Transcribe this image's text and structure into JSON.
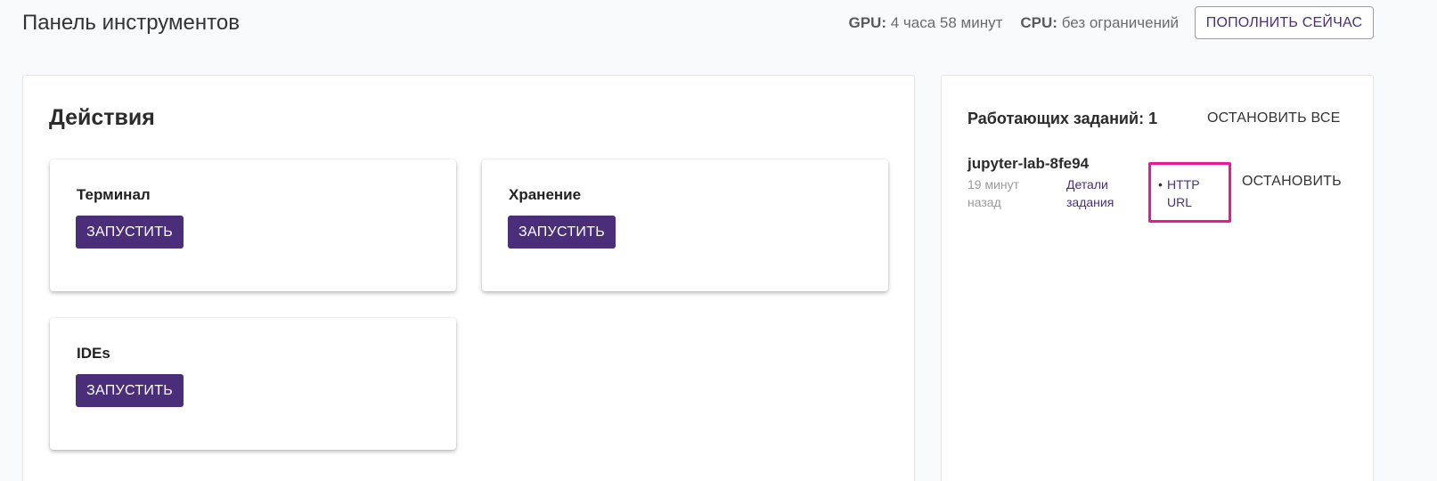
{
  "header": {
    "title": "Панель инструментов",
    "gpu_label": "GPU:",
    "gpu_value": "4 часа 58 минут",
    "cpu_label": "CPU:",
    "cpu_value": "без ограничений",
    "topup_label": "ПОПОЛНИТЬ СЕЙЧАС"
  },
  "actions": {
    "title": "Действия",
    "cards": [
      {
        "title": "Терминал",
        "button": "ЗАПУСТИТЬ"
      },
      {
        "title": "Хранение",
        "button": "ЗАПУСТИТЬ"
      },
      {
        "title": "IDEs",
        "button": "ЗАПУСТИТЬ"
      }
    ]
  },
  "jobs": {
    "title": "Работающих заданий: 1",
    "stop_all_label": "ОСТАНОВИТЬ ВСЕ",
    "items": [
      {
        "name": "jupyter-lab-8fe94",
        "time": "19 минут назад",
        "details_label": "Детали задания",
        "bullet": "•",
        "link_label": "HTTP URL",
        "stop_label": "ОСТАНОВИТЬ"
      }
    ]
  },
  "colors": {
    "accent": "#4b2e7a",
    "highlight": "#ee1793",
    "background": "#f9fafc"
  }
}
